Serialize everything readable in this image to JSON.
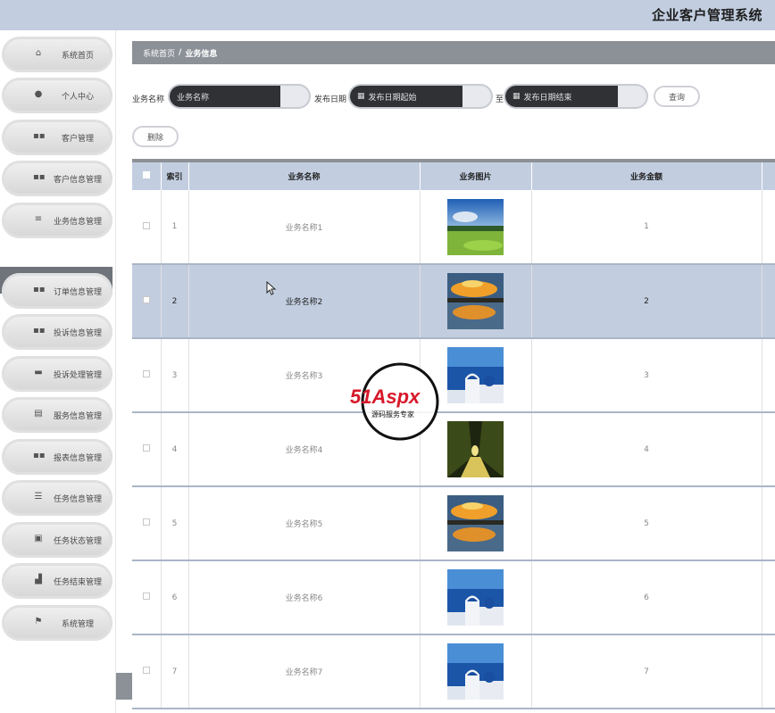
{
  "app": {
    "title": "企业客户管理系统"
  },
  "sidebar": {
    "items": [
      {
        "label": "系统首页",
        "icon": "home-icon"
      },
      {
        "label": "个人中心",
        "icon": "user-icon"
      },
      {
        "label": "客户管理",
        "icon": "grid-icon"
      },
      {
        "label": "客户信息管理",
        "icon": "grid-icon"
      },
      {
        "label": "业务信息管理",
        "icon": "list-icon"
      },
      {
        "label": "订单信息管理",
        "icon": "grid-icon"
      },
      {
        "label": "投诉信息管理",
        "icon": "grid-icon"
      },
      {
        "label": "投诉处理管理",
        "icon": "chat-icon"
      },
      {
        "label": "服务信息管理",
        "icon": "clipboard-icon"
      },
      {
        "label": "报表信息管理",
        "icon": "grid-icon"
      },
      {
        "label": "任务信息管理",
        "icon": "sliders-icon"
      },
      {
        "label": "任务状态管理",
        "icon": "clipboard-check-icon"
      },
      {
        "label": "任务结束管理",
        "icon": "thumb-icon"
      },
      {
        "label": "系统管理",
        "icon": "flag-icon"
      }
    ],
    "submenu": {
      "label": "业务信息"
    }
  },
  "breadcrumb": {
    "home": "系统首页",
    "separator": "/",
    "current": "业务信息"
  },
  "filters": {
    "name_label": "业务名称",
    "name_placeholder": "业务名称",
    "date_label": "发布日期",
    "date_start_placeholder": "发布日期起始",
    "date_to": "至",
    "date_end_placeholder": "发布日期结束",
    "search_button": "查询",
    "delete_button": "删除"
  },
  "table": {
    "columns": [
      "索引",
      "业务名称",
      "业务图片",
      "业务金额"
    ],
    "rows": [
      {
        "index": "1",
        "name": "业务名称1",
        "image": "golf-course",
        "amount": "1",
        "selected": false
      },
      {
        "index": "2",
        "name": "业务名称2",
        "image": "sunset-lake",
        "amount": "2",
        "selected": true
      },
      {
        "index": "3",
        "name": "业务名称3",
        "image": "santorini",
        "amount": "3",
        "selected": false
      },
      {
        "index": "4",
        "name": "业务名称4",
        "image": "tree-avenue",
        "amount": "4",
        "selected": false
      },
      {
        "index": "5",
        "name": "业务名称5",
        "image": "sunset-lake",
        "amount": "5",
        "selected": false
      },
      {
        "index": "6",
        "name": "业务名称6",
        "image": "santorini",
        "amount": "6",
        "selected": false
      },
      {
        "index": "7",
        "name": "业务名称7",
        "image": "santorini",
        "amount": "7",
        "selected": false
      }
    ]
  },
  "watermark": {
    "brand": "51Aspx",
    "slogan": "源码服务专家"
  },
  "colors": {
    "accent": "#c2cee0",
    "dark": "#8c9097",
    "brand_red": "#d7192a",
    "brand_green": "#2f9a3a"
  }
}
